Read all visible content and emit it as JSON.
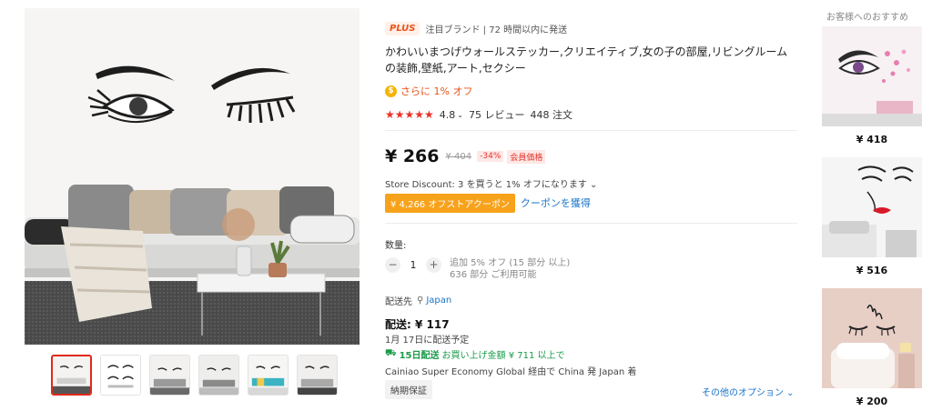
{
  "gallery": {
    "main_image": "wall-decal-eyelashes-living-room",
    "thumbnail_count": 6,
    "active_thumbnail": 1
  },
  "brand": {
    "badge": "PLUS",
    "text": "注目ブランド | 72 時間以内に発送"
  },
  "product": {
    "title": "かわいいまつげウォールステッカー,クリエイティブ,女の子の部屋,リビングルームの装飾,壁紙,アート,セクシー"
  },
  "extra_discount": {
    "icon": "coin-icon",
    "text": "さらに 1% オフ"
  },
  "rating": {
    "stars": "★★★★★",
    "score": "4.8",
    "reviews": "75 レビュー",
    "orders": "448 注文"
  },
  "price": {
    "current": "¥ 266",
    "original": "¥ 404",
    "discount": "-34%",
    "member": "会員価格"
  },
  "store_discount": "Store Discount: 3 を買うと 1% オフになります ⌄",
  "coupon": {
    "label": "¥ 4,266 オフストアクーポン",
    "link": "クーポンを獲得"
  },
  "quantity": {
    "label": "数量:",
    "minus": "−",
    "value": "1",
    "plus": "+",
    "note_1": "追加 5% オフ (15 部分 以上)",
    "note_2": "636 部分 ご利用可能"
  },
  "shipping": {
    "to_label": "配送先",
    "country": "Japan",
    "price": "配送: ¥ 117",
    "date": "1月 17日に配送予定",
    "free_days": "15日配送",
    "free_text": "お買い上げ金額 ¥ 711 以上で",
    "carrier": "Cainiao Super Economy Global 経由で China 発 Japan 着",
    "guarantee": "納期保証",
    "more_options": "その他のオプション ⌄"
  },
  "recommendations": {
    "title": "お客様へのおすすめ",
    "items": [
      {
        "price": "¥ 418"
      },
      {
        "price": "¥ 516"
      },
      {
        "price": "¥ 200"
      }
    ]
  },
  "colors": {
    "accent": "#e8541a",
    "star": "#e8322a",
    "coupon": "#f7a21b",
    "link": "#1a73c9",
    "free_ship": "#1a9b4a"
  }
}
